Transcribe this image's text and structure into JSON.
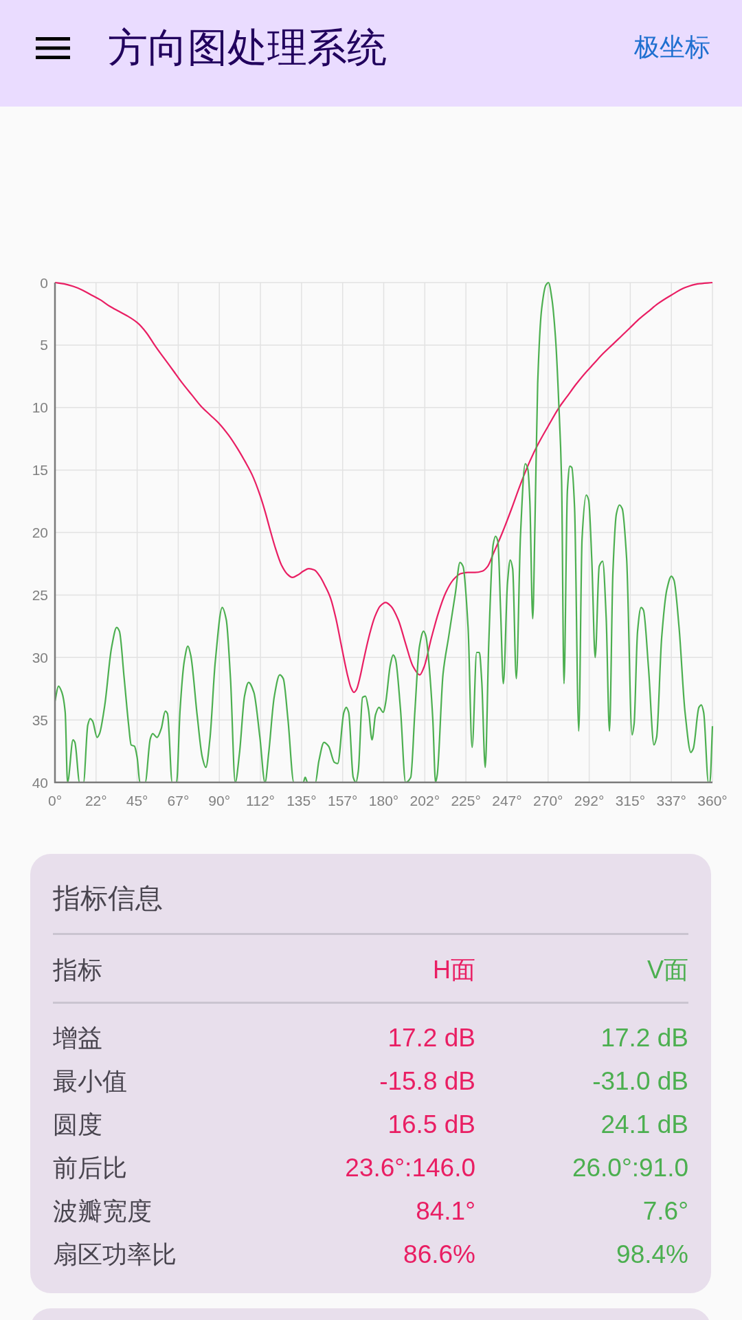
{
  "app_bar": {
    "title": "方向图处理系统",
    "action": "极坐标"
  },
  "pattern_chart": {
    "chart_data": {
      "type": "line",
      "grid": true,
      "xlim": [
        0,
        360
      ],
      "ylim": [
        -40,
        0
      ],
      "xticks": [
        {
          "value": 0,
          "label": "0°"
        },
        {
          "value": 22.5,
          "label": "22°"
        },
        {
          "value": 45,
          "label": "45°"
        },
        {
          "value": 67.5,
          "label": "67°"
        },
        {
          "value": 90,
          "label": "90°"
        },
        {
          "value": 112.5,
          "label": "112°"
        },
        {
          "value": 135,
          "label": "135°"
        },
        {
          "value": 157.5,
          "label": "157°"
        },
        {
          "value": 180,
          "label": "180°"
        },
        {
          "value": 202.5,
          "label": "202°"
        },
        {
          "value": 225,
          "label": "225°"
        },
        {
          "value": 247.5,
          "label": "247°"
        },
        {
          "value": 270,
          "label": "270°"
        },
        {
          "value": 292.5,
          "label": "292°"
        },
        {
          "value": 315,
          "label": "315°"
        },
        {
          "value": 337.5,
          "label": "337°"
        },
        {
          "value": 360,
          "label": "360°"
        }
      ],
      "yticks": [
        {
          "value": 0,
          "label": "0"
        },
        {
          "value": -5,
          "label": "5"
        },
        {
          "value": -10,
          "label": "10"
        },
        {
          "value": -15,
          "label": "15"
        },
        {
          "value": -20,
          "label": "20"
        },
        {
          "value": -25,
          "label": "25"
        },
        {
          "value": -30,
          "label": "30"
        },
        {
          "value": -35,
          "label": "35"
        },
        {
          "value": -40,
          "label": "40"
        }
      ],
      "series": [
        {
          "color": "#e91e63",
          "x": [
            0,
            5,
            10,
            15,
            20,
            25,
            30,
            35,
            40,
            45,
            50,
            55,
            60,
            65,
            70,
            75,
            80,
            85,
            90,
            95,
            100,
            104,
            108,
            112,
            115,
            118,
            121,
            124,
            127,
            130,
            133,
            136,
            139,
            142,
            145,
            148,
            151,
            154,
            157,
            160,
            162,
            163.7,
            165,
            167,
            169,
            172,
            175,
            178,
            181,
            184,
            188,
            192,
            196,
            199.7,
            202,
            206,
            210,
            214,
            218,
            222,
            226,
            230,
            234,
            237,
            240,
            245,
            250,
            255,
            260,
            265,
            270,
            276,
            280,
            285,
            290,
            295,
            300,
            305,
            310,
            315,
            320,
            325,
            330,
            337.5,
            345,
            352,
            360
          ],
          "values": [
            0,
            -0.1,
            -0.3,
            -0.6,
            -1.0,
            -1.4,
            -1.9,
            -2.3,
            -2.7,
            -3.2,
            -4.0,
            -5.1,
            -6.1,
            -7.1,
            -8.1,
            -9.0,
            -9.9,
            -10.6,
            -11.3,
            -12.2,
            -13.3,
            -14.3,
            -15.4,
            -16.9,
            -18.3,
            -19.9,
            -21.4,
            -22.6,
            -23.3,
            -23.6,
            -23.4,
            -23.1,
            -22.9,
            -23.0,
            -23.5,
            -24.3,
            -25.3,
            -27.0,
            -29.2,
            -31.3,
            -32.4,
            -32.8,
            -32.6,
            -31.6,
            -30.2,
            -28.3,
            -26.8,
            -25.9,
            -25.6,
            -25.9,
            -27.0,
            -28.9,
            -30.7,
            -31.4,
            -30.8,
            -28.5,
            -26.4,
            -24.8,
            -23.8,
            -23.3,
            -23.2,
            -23.2,
            -23.1,
            -22.7,
            -21.7,
            -20.0,
            -18.1,
            -16.1,
            -14.3,
            -12.8,
            -11.5,
            -10.0,
            -9.2,
            -8.2,
            -7.3,
            -6.5,
            -5.7,
            -5.0,
            -4.3,
            -3.6,
            -2.9,
            -2.3,
            -1.7,
            -1.0,
            -0.4,
            -0.1,
            0
          ]
        },
        {
          "color": "#4caf50",
          "x": [
            0,
            1.9,
            3.8,
            5.6,
            6.9,
            9.9,
            10.9,
            13.5,
            15.6,
            18,
            19.3,
            20.6,
            23.1,
            24.4,
            27.2,
            31,
            33.8,
            35.3,
            37.9,
            40.4,
            41.7,
            43.5,
            45,
            46.5,
            49.4,
            52.2,
            53.5,
            55.9,
            58.2,
            60.4,
            61.6,
            64.2,
            66.6,
            68.5,
            70.8,
            72.8,
            74.3,
            77.9,
            80.7,
            82.6,
            84.8,
            87.8,
            91.6,
            93.8,
            96.1,
            98.7,
            101,
            103.8,
            106,
            108.9,
            112.2,
            115,
            117,
            120.1,
            123.1,
            125,
            127.6,
            130.8,
            136,
            137,
            138.3,
            142.6,
            144.5,
            147.3,
            149.8,
            153,
            154.8,
            158.2,
            159.5,
            160.8,
            163.3,
            164.8,
            166.1,
            168.4,
            170,
            171.7,
            173.6,
            175.5,
            177.4,
            179.8,
            181.1,
            183.6,
            185.2,
            186.4,
            189.2,
            192,
            194.8,
            197.1,
            199.5,
            201.8,
            203.1,
            205,
            206.9,
            208.4,
            209.3,
            212.5,
            215.5,
            219.2,
            221.8,
            223.4,
            226.2,
            228.4,
            230.9,
            232.4,
            233.7,
            235.6,
            237.5,
            239.9,
            241.2,
            242.5,
            244,
            245.5,
            247.8,
            249.3,
            250.6,
            252.6,
            254.9,
            257.5,
            259,
            260,
            261.6,
            262.8,
            264.3,
            266.5,
            268.8,
            270.2,
            272.1,
            274,
            275.9,
            277.4,
            278.7,
            280.6,
            281.9,
            283,
            284.5,
            286.8,
            288.6,
            290.9,
            292.2,
            293.9,
            295.8,
            298,
            299.9,
            301.8,
            303.6,
            305.5,
            307.4,
            309.1,
            310.6,
            313,
            316,
            317.1,
            319,
            320.9,
            322.2,
            325,
            328,
            329.4,
            332.2,
            335,
            337.5,
            338.9,
            341.7,
            345,
            348.2,
            349.5,
            352.6,
            353.9,
            355.2,
            357.8,
            358.6,
            360
          ],
          "values": [
            -33.5,
            -32.3,
            -32.8,
            -34.4,
            -40,
            -36.6,
            -36.8,
            -40,
            -40,
            -35.4,
            -34.9,
            -35.1,
            -36.4,
            -36.1,
            -33.9,
            -29.2,
            -27.6,
            -27.9,
            -31.7,
            -35.5,
            -37,
            -37.1,
            -38,
            -40,
            -40,
            -36.5,
            -36.1,
            -36.4,
            -35.7,
            -34.3,
            -34.5,
            -40,
            -40,
            -34.2,
            -30.3,
            -29.1,
            -29.8,
            -34.7,
            -38,
            -38.8,
            -36.6,
            -30.3,
            -26,
            -27,
            -31.7,
            -40,
            -37.7,
            -33.1,
            -32,
            -32.8,
            -36.4,
            -40,
            -37.7,
            -33.1,
            -31.4,
            -31.7,
            -35,
            -40,
            -40,
            -39.6,
            -40,
            -40,
            -38.3,
            -36.8,
            -37.1,
            -38.4,
            -38.5,
            -34.4,
            -34,
            -34.4,
            -39.6,
            -40,
            -39.1,
            -33.2,
            -33.1,
            -34.2,
            -36.6,
            -34.6,
            -34,
            -34.4,
            -33.6,
            -30.6,
            -29.8,
            -30.1,
            -34.2,
            -40,
            -39.6,
            -34.2,
            -29.2,
            -27.9,
            -28.3,
            -30.9,
            -35,
            -40,
            -39.4,
            -31.3,
            -28.4,
            -24.9,
            -22.4,
            -22.7,
            -27.6,
            -37.2,
            -29.6,
            -29.6,
            -32,
            -38.8,
            -28.9,
            -21,
            -20.3,
            -20.7,
            -26.2,
            -32.1,
            -24,
            -22.2,
            -22.9,
            -31.7,
            -20.2,
            -14.5,
            -15,
            -17.5,
            -26.9,
            -19.4,
            -8.1,
            -2.1,
            -0.2,
            0,
            -1.3,
            -4.3,
            -9.8,
            -15.8,
            -32.1,
            -16.6,
            -14.7,
            -14.8,
            -18,
            -35.9,
            -20.5,
            -17,
            -17.4,
            -22.1,
            -30,
            -22.7,
            -22.3,
            -26.8,
            -35.9,
            -23.2,
            -18.5,
            -17.8,
            -18.1,
            -22.1,
            -36.2,
            -35.3,
            -27.9,
            -26,
            -26.2,
            -30.9,
            -37,
            -36.4,
            -28.4,
            -24.6,
            -23.5,
            -23.8,
            -27.6,
            -34.4,
            -37.6,
            -37.3,
            -34,
            -33.8,
            -34.4,
            -40,
            -40,
            -35.5
          ]
        }
      ]
    }
  },
  "metrics_card": {
    "title": "指标信息",
    "columns": [
      {
        "label": "指标"
      },
      {
        "label": "H面",
        "color": "#e91e63"
      },
      {
        "label": "V面",
        "color": "#4caf50"
      }
    ],
    "rows": [
      {
        "label": "增益",
        "values": [
          "17.2 dB",
          "17.2 dB"
        ]
      },
      {
        "label": "最小值",
        "values": [
          "-15.8 dB",
          "-31.0 dB"
        ]
      },
      {
        "label": "圆度",
        "values": [
          "16.5 dB",
          "24.1 dB"
        ]
      },
      {
        "label": "前后比",
        "values": [
          "23.6°:146.0",
          "26.0°:91.0"
        ]
      },
      {
        "label": "波瓣宽度",
        "values": [
          "84.1°",
          "7.6°"
        ]
      },
      {
        "label": "扇区功率比",
        "values": [
          "86.6%",
          "98.4%"
        ]
      }
    ]
  }
}
